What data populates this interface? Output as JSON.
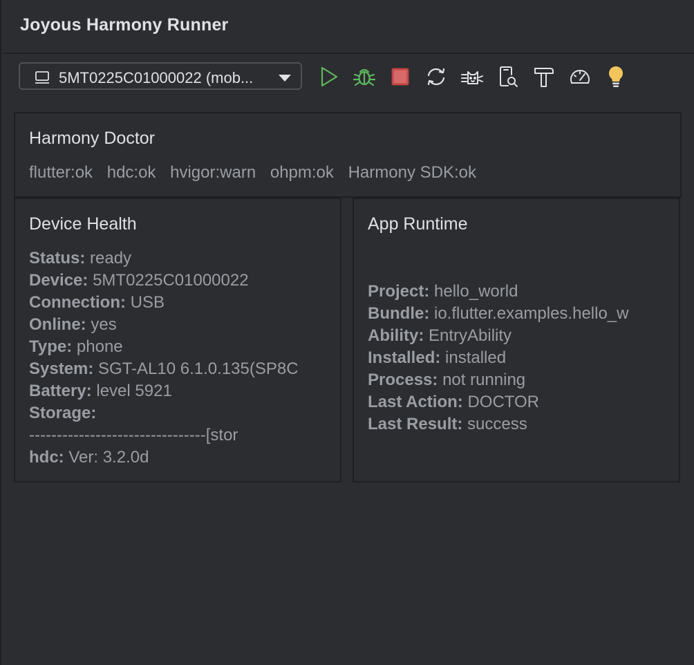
{
  "window": {
    "title": "Joyous Harmony Runner"
  },
  "toolbar": {
    "device_selector": {
      "label": "5MT0225C01000022 (mob...",
      "icon": "device-monitor-icon"
    },
    "buttons": [
      {
        "name": "run-button",
        "icon": "play-icon",
        "color": "#5fb85f"
      },
      {
        "name": "debug-button",
        "icon": "bug-icon",
        "color": "#5fb85f"
      },
      {
        "name": "stop-button",
        "icon": "stop-icon",
        "color": "#c94f4f"
      },
      {
        "name": "hot-reload-button",
        "icon": "refresh-icon",
        "color": "#dfe1e5"
      },
      {
        "name": "devtools-button",
        "icon": "cat-icon",
        "color": "#dfe1e5"
      },
      {
        "name": "device-inspect-button",
        "icon": "device-search-icon",
        "color": "#dfe1e5"
      },
      {
        "name": "build-button",
        "icon": "hammer-icon",
        "color": "#dfe1e5"
      },
      {
        "name": "performance-button",
        "icon": "gauge-icon",
        "color": "#dfe1e5"
      },
      {
        "name": "tips-button",
        "icon": "lightbulb-icon",
        "color": "#f2c55c"
      }
    ]
  },
  "doctor": {
    "heading": "Harmony Doctor",
    "checks": [
      "flutter:ok",
      "hdc:ok",
      "hvigor:warn",
      "ohpm:ok",
      "Harmony SDK:ok"
    ]
  },
  "device_health": {
    "heading": "Device Health",
    "status_key": "Status:",
    "status_value": "ready",
    "device_key": "Device:",
    "device_value": "5MT0225C01000022",
    "connection_key": "Connection:",
    "connection_value": "USB",
    "online_key": "Online:",
    "online_value": "yes",
    "type_key": "Type:",
    "type_value": "phone",
    "system_key": "System:",
    "system_value": "SGT-AL10 6.1.0.135(SP8C",
    "battery_key": "Battery:",
    "battery_value": "level 5921",
    "storage_key": "Storage:",
    "storage_value": "--------------------------------[stor",
    "hdc_key": "hdc:",
    "hdc_value": "Ver: 3.2.0d"
  },
  "app_runtime": {
    "heading": "App Runtime",
    "project_key": "Project:",
    "project_value": "hello_world",
    "bundle_key": "Bundle:",
    "bundle_value": "io.flutter.examples.hello_w",
    "ability_key": "Ability:",
    "ability_value": "EntryAbility",
    "installed_key": "Installed:",
    "installed_value": "installed",
    "process_key": "Process:",
    "process_value": "not running",
    "last_action_key": "Last Action:",
    "last_action_value": "DOCTOR",
    "last_result_key": "Last Result:",
    "last_result_value": "success"
  }
}
